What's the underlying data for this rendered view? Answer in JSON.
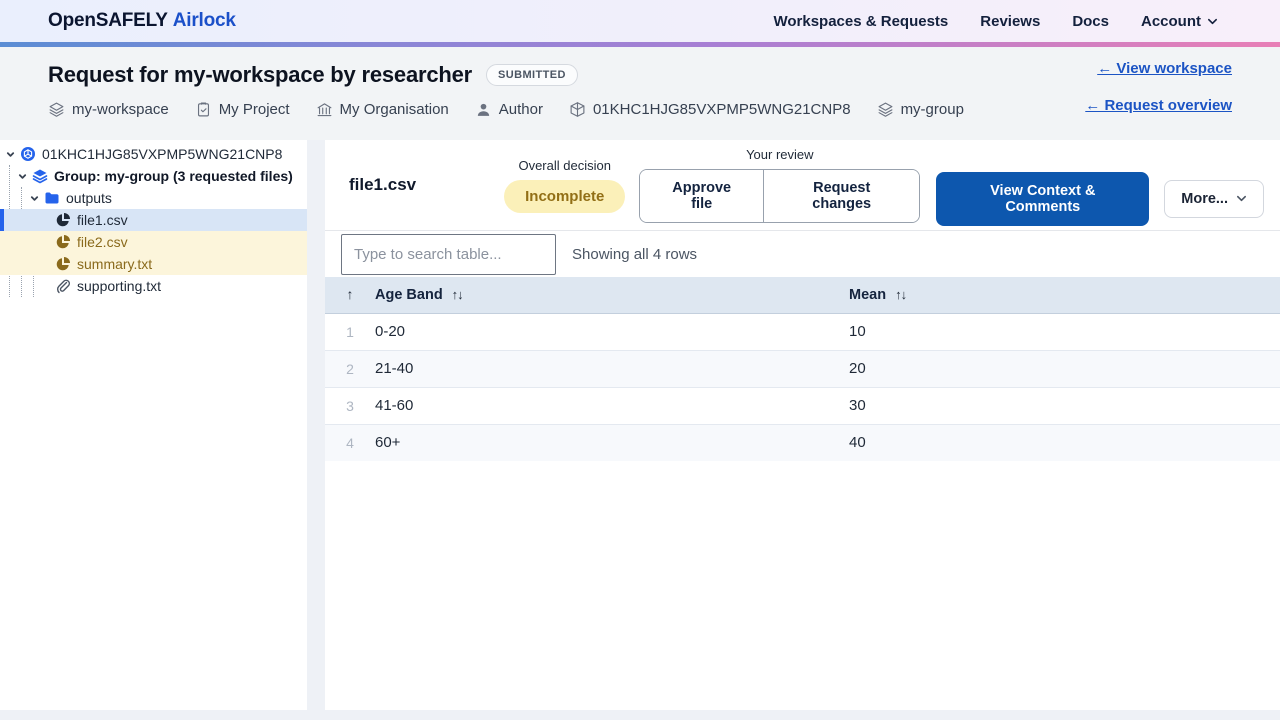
{
  "navbar": {
    "brand_primary": "OpenSAFELY",
    "brand_accent": "Airlock",
    "items": [
      {
        "label": "Workspaces & Requests"
      },
      {
        "label": "Reviews"
      },
      {
        "label": "Docs"
      },
      {
        "label": "Account"
      }
    ]
  },
  "header": {
    "title": "Request for my-workspace by researcher",
    "status_badge": "SUBMITTED",
    "links": [
      {
        "label": "← View workspace"
      },
      {
        "label": "← Request overview"
      }
    ],
    "meta": [
      {
        "icon": "layers-icon",
        "label": "my-workspace"
      },
      {
        "icon": "clipboard-icon",
        "label": "My Project"
      },
      {
        "icon": "bank-icon",
        "label": "My Organisation"
      },
      {
        "icon": "user-icon",
        "label": "Author"
      },
      {
        "icon": "cube-icon",
        "label": "01KHC1HJG85VXPMP5WNG21CNP8"
      },
      {
        "icon": "layers-icon",
        "label": "my-group"
      }
    ]
  },
  "sidebar": {
    "tree": [
      {
        "label": "01KHC1HJG85VXPMP5WNG21CNP8",
        "icon": "request-icon",
        "expanded": true
      },
      {
        "label": "Group: my-group (3 requested files)",
        "icon": "group-layers-icon",
        "expanded": true
      },
      {
        "label": "outputs",
        "icon": "folder-icon",
        "expanded": true
      },
      {
        "label": "file1.csv",
        "icon": "file-chart-icon",
        "state": "selected"
      },
      {
        "label": "file2.csv",
        "icon": "file-chart-icon",
        "state": "attention"
      },
      {
        "label": "summary.txt",
        "icon": "file-chart-icon",
        "state": "attention"
      },
      {
        "label": "supporting.txt",
        "icon": "paperclip-icon",
        "state": "default"
      }
    ]
  },
  "main": {
    "file_title": "file1.csv",
    "overall_decision_label": "Overall decision",
    "decision_badge": "Incomplete",
    "your_review_label": "Your review",
    "approve_button": "Approve file",
    "request_changes_button": "Request changes",
    "context_button": "View Context & Comments",
    "more_button": "More...",
    "search_placeholder": "Type to search table...",
    "rows_status": "Showing all 4 rows",
    "table": {
      "columns": [
        {
          "label": "Age Band"
        },
        {
          "label": "Mean"
        }
      ],
      "rows": [
        {
          "num": "1",
          "age_band": "0-20",
          "mean": "10"
        },
        {
          "num": "2",
          "age_band": "21-40",
          "mean": "20"
        },
        {
          "num": "3",
          "age_band": "41-60",
          "mean": "30"
        },
        {
          "num": "4",
          "age_band": "60+",
          "mean": "40"
        }
      ]
    }
  },
  "colors": {
    "brand_accent_blue": "#1b50c9",
    "primary_button_blue": "#0d57ae",
    "decision_badge_bg": "#fbf0b9",
    "decision_badge_text": "#926f16",
    "attention_row_bg": "#fcf5db",
    "attention_row_text": "#8a6a1c",
    "selected_row_bg": "#d8e5f6",
    "topbar_gradient": [
      "#5b8dd4",
      "#a77fd4",
      "#e87fb6"
    ]
  }
}
